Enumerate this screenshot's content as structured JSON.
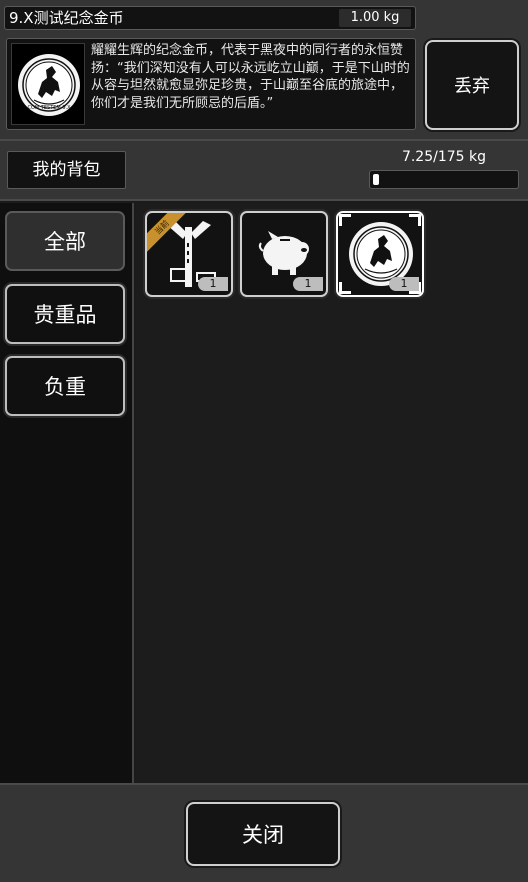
{
  "selected_item": {
    "name": "9.X测试纪念金币",
    "weight": "1.00 kg",
    "description": "耀耀生辉的纪念金币，代表于黑夜中的同行者的永恒赞扬：“我们深知没有人可以永远屹立山巅，于是下山时的从容与坦然就愈显弥足珍贵，于山巅至谷底的旅途中，你们才是我们无所顾忌的后盾。”",
    "icon": "commemorative-coin-icon",
    "coin_text": "COM TESTEM 9.X"
  },
  "actions": {
    "discard_label": "丢弃",
    "close_label": "关闭"
  },
  "bag": {
    "title": "我的背包",
    "capacity_text": "7.25/175 kg",
    "capacity_fraction": 0.0414
  },
  "categories": [
    {
      "label": "全部",
      "active": true
    },
    {
      "label": "贵重品",
      "active": false
    },
    {
      "label": "负重",
      "active": false
    }
  ],
  "items": [
    {
      "icon": "signpost-icon",
      "count": "1",
      "badge": "当前"
    },
    {
      "icon": "piggy-bank-icon",
      "count": "1"
    },
    {
      "icon": "commemorative-coin-icon",
      "count": "1",
      "selected": true
    }
  ],
  "colors": {
    "panel_bg": "#353535",
    "dark_bg": "#121212",
    "border_light": "#cfcfcf",
    "badge_orange": "#c8912e"
  }
}
